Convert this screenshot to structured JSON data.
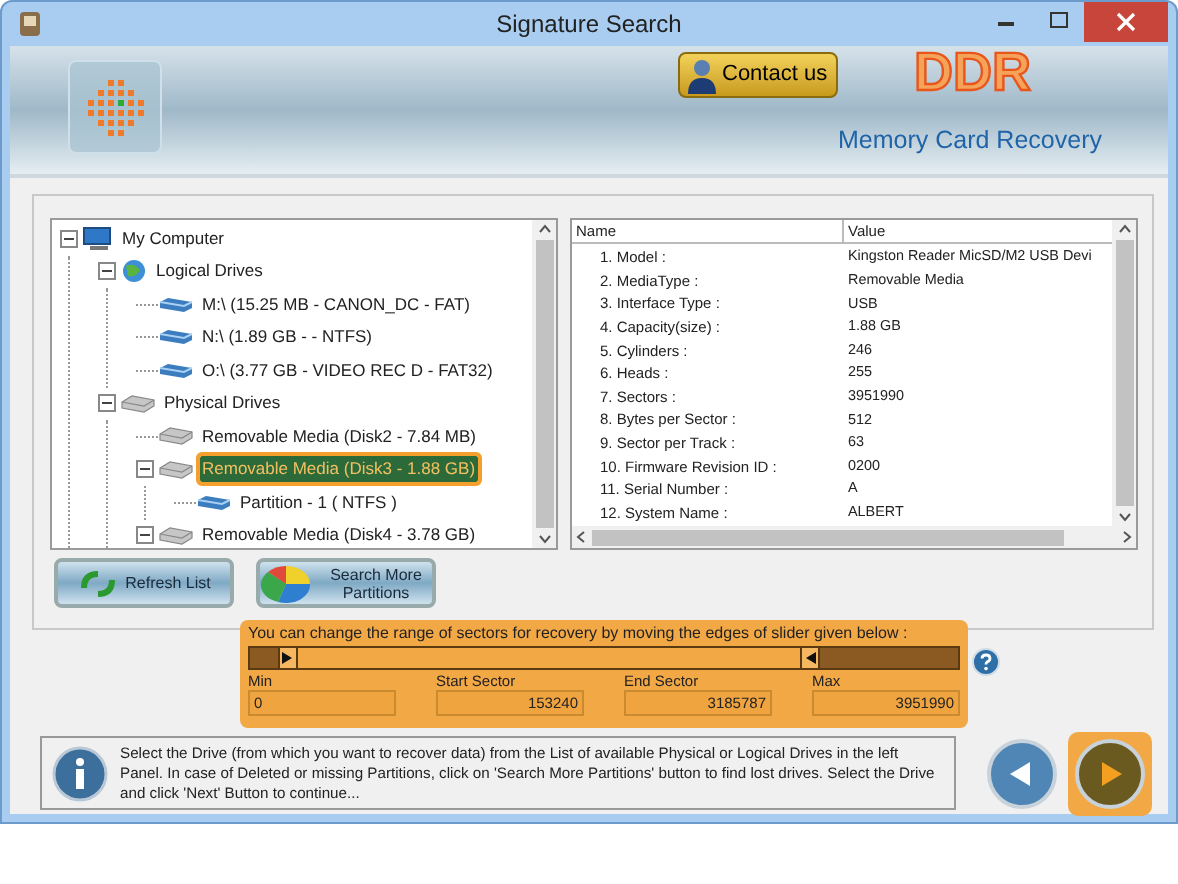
{
  "window": {
    "title": "Signature Search"
  },
  "header": {
    "contact_button": "Contact us",
    "brand": "DDR",
    "product": "Memory Card Recovery"
  },
  "tree": [
    {
      "label": "My Computer",
      "kind": "computer",
      "expanded": true,
      "selected": false,
      "children": [
        {
          "label": "Logical Drives",
          "kind": "globe",
          "expanded": true,
          "selected": false,
          "children": [
            {
              "label": "M:\\ (15.25 MB - CANON_DC - FAT)",
              "kind": "drive",
              "selected": false
            },
            {
              "label": "N:\\ (1.89 GB -  - NTFS)",
              "kind": "drive",
              "selected": false
            },
            {
              "label": "O:\\ (3.77 GB - VIDEO REC D - FAT32)",
              "kind": "drive",
              "selected": false
            }
          ]
        },
        {
          "label": "Physical Drives",
          "kind": "disk",
          "expanded": true,
          "selected": false,
          "children": [
            {
              "label": "Removable Media (Disk2 - 7.84 MB)",
              "kind": "disk",
              "selected": false
            },
            {
              "label": "Removable Media (Disk3 - 1.88 GB)",
              "kind": "disk",
              "expanded": true,
              "selected": true,
              "children": [
                {
                  "label": "Partition - 1 ( NTFS )",
                  "kind": "drive",
                  "selected": false
                }
              ]
            },
            {
              "label": "Removable Media (Disk4 - 3.78 GB)",
              "kind": "disk",
              "expanded": true,
              "selected": false
            }
          ]
        }
      ]
    }
  ],
  "properties": {
    "columns": [
      "Name",
      "Value"
    ],
    "rows": [
      {
        "name": "1. Model :",
        "value": "Kingston Reader  MicSD/M2 USB Devi"
      },
      {
        "name": "2. MediaType :",
        "value": "Removable Media"
      },
      {
        "name": "3. Interface Type :",
        "value": "USB"
      },
      {
        "name": "4. Capacity(size) :",
        "value": "1.88 GB"
      },
      {
        "name": "5. Cylinders :",
        "value": "246"
      },
      {
        "name": "6. Heads :",
        "value": "255"
      },
      {
        "name": "7. Sectors :",
        "value": "3951990"
      },
      {
        "name": "8. Bytes per Sector :",
        "value": "512"
      },
      {
        "name": "9. Sector per Track :",
        "value": "63"
      },
      {
        "name": "10. Firmware Revision ID :",
        "value": "0200"
      },
      {
        "name": "11. Serial Number :",
        "value": "A"
      },
      {
        "name": "12. System Name :",
        "value": "ALBERT"
      }
    ]
  },
  "buttons": [
    {
      "label": "Refresh List",
      "kind": "refresh"
    },
    {
      "label": "Search More Partitions",
      "kind": "pie"
    }
  ],
  "sector_range": {
    "instruction": "You can change the range of sectors for recovery by moving the edges of slider given below :",
    "start_handle": {
      "level": 0.039
    },
    "end_handle": {
      "level": 0.806
    },
    "fields": [
      {
        "label": "Min",
        "value": "0"
      },
      {
        "label": "Start Sector",
        "value": "153240"
      },
      {
        "label": "End Sector",
        "value": "3185787"
      },
      {
        "label": "Max",
        "value": "3951990"
      }
    ]
  },
  "info": "Select the Drive (from which you want to recover data) from the List of available Physical or Logical Drives in the left Panel. In case of Deleted or missing Partitions, click on 'Search More Partitions' button to find lost drives. Select the Drive and click 'Next' Button to continue...",
  "nav": [
    {
      "kind": "back",
      "highlighted": false
    },
    {
      "kind": "next",
      "highlighted": true
    }
  ]
}
